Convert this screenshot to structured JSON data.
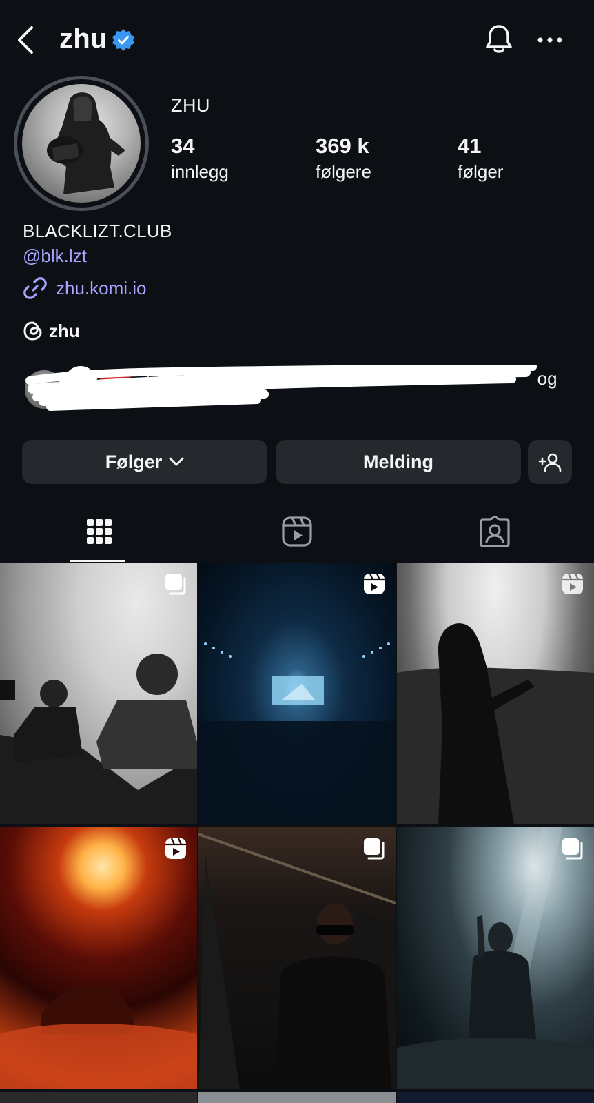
{
  "header": {
    "username": "zhu",
    "verified_color": "#3897f0"
  },
  "profile": {
    "display_name": "ZHU",
    "stats": [
      {
        "value": "34",
        "label": "innlegg"
      },
      {
        "value": "369 k",
        "label": "følgere"
      },
      {
        "value": "41",
        "label": "følger"
      }
    ],
    "bio_line_1": "BLACKLIZT.CLUB",
    "bio_mention": "@blk.lzt",
    "link": "zhu.komi.io",
    "threads_handle": "zhu",
    "followed_by_text": "Følges av",
    "followed_by_suffix": "og"
  },
  "actions": {
    "follow_label": "Følger",
    "message_label": "Melding"
  },
  "tabs": [
    "grid-icon",
    "reels-icon",
    "tagged-icon"
  ],
  "posts": [
    {
      "type": "carousel"
    },
    {
      "type": "reel"
    },
    {
      "type": "reel"
    },
    {
      "type": "reel"
    },
    {
      "type": "carousel"
    },
    {
      "type": "carousel"
    }
  ],
  "colors": {
    "background": "#0c1014",
    "link": "#a8a4ff",
    "button": "#25292e"
  }
}
